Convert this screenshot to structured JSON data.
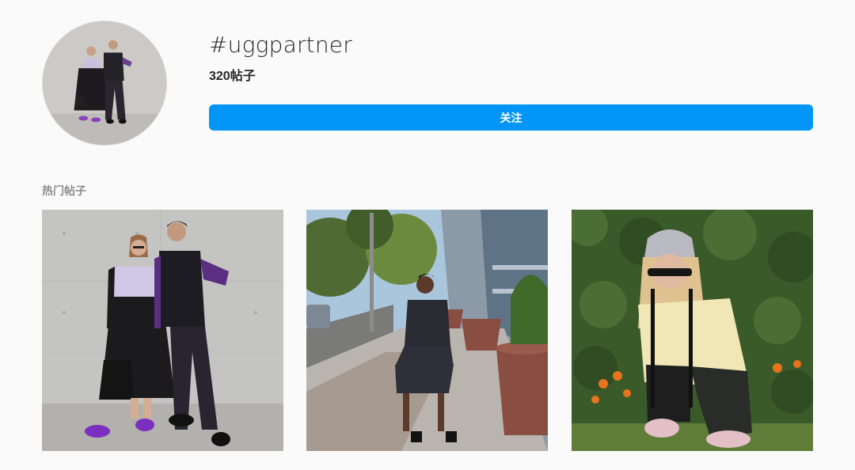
{
  "header": {
    "hashtag": "#uggpartner",
    "post_count": "320帖子",
    "follow_label": "关注"
  },
  "top_posts": {
    "title": "热门帖子",
    "items": [
      {
        "scene": "couple-concrete-wall"
      },
      {
        "scene": "woman-city-sidewalk"
      },
      {
        "scene": "woman-crouching-ivy-wall"
      }
    ]
  },
  "colors": {
    "accent": "#0095f6",
    "background": "#fafafa",
    "muted_text": "#8e8e8e"
  }
}
